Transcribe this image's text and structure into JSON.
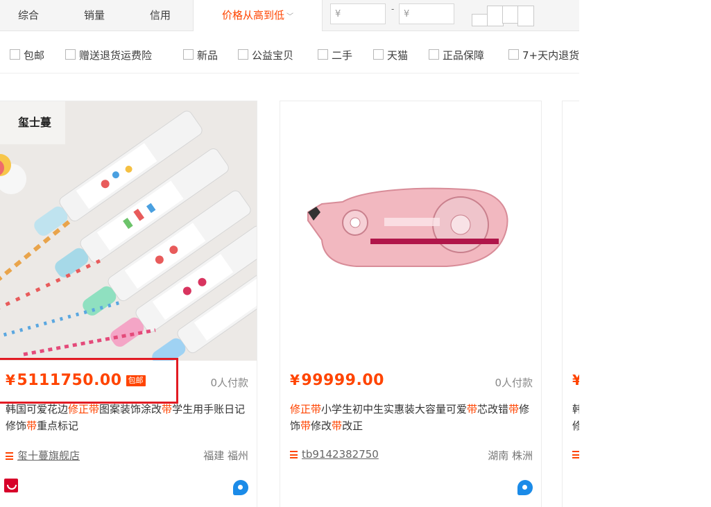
{
  "sort_tabs": [
    {
      "label": "综合"
    },
    {
      "label": "销量"
    },
    {
      "label": "信用"
    },
    {
      "label": "价格从高到低",
      "chevron": "﹀"
    }
  ],
  "price_filter": {
    "min_placeholder": "¥",
    "max_placeholder": "¥",
    "separator": "-"
  },
  "filters": [
    "包邮",
    "赠送退货运费险",
    "新品",
    "公益宝贝",
    "二手",
    "天猫",
    "正品保障",
    "7+天内退货"
  ],
  "products": [
    {
      "price": "5111750.00",
      "yen": "¥",
      "free_shipping_badge": "包邮",
      "deals": "0人付款",
      "title_parts": [
        "韩国可爱花边",
        "修正带",
        "图案装饰涂改",
        "带",
        "学生用手账日记修饰",
        "带",
        "重点标记"
      ],
      "shop": "玺十蔓旗舰店",
      "location": "福建 福州",
      "brand_logo_text": "玺士蔓"
    },
    {
      "price": "99999.00",
      "yen": "¥",
      "deals": "0人付款",
      "title_parts": [
        "",
        "修正带",
        "小学生初中生实惠装大容量可爱",
        "带",
        "芯改错",
        "带",
        "修饰",
        "带",
        "修改",
        "带",
        "改正"
      ],
      "shop": "tb9142382750",
      "location": "湖南 株洲"
    },
    {
      "yen": "¥",
      "title_fragment_1": "韩",
      "title_fragment_2": "修"
    }
  ],
  "colors": {
    "accent": "#ff4400",
    "highlight": "#e21b23",
    "tmall": "#d7002a",
    "wangwang": "#1b8be8"
  },
  "icons": [
    "shop-list-icon",
    "tmall-badge-icon",
    "wangwang-chat-icon"
  ]
}
